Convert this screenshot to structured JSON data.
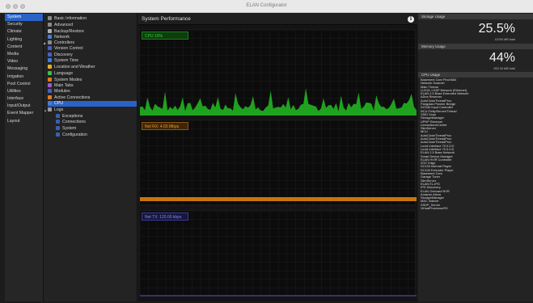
{
  "window": {
    "title": "ELAN Configurator"
  },
  "nav": {
    "items": [
      "System",
      "Security",
      "Climate",
      "Lighting",
      "Content",
      "Media",
      "Video",
      "Messaging",
      "Irrigation",
      "Pool Control",
      "Utilities",
      "Interface",
      "Input/Output",
      "Event Mapper",
      "Layout"
    ],
    "active_index": 0
  },
  "tree": {
    "items": [
      {
        "label": "Basic Information",
        "icon": "grid-icon",
        "color": "#8a8a8a",
        "indent": 0
      },
      {
        "label": "Advanced",
        "icon": "grid-icon",
        "color": "#8a8a8a",
        "indent": 0
      },
      {
        "label": "Backup/Restore",
        "icon": "backup-icon",
        "color": "#b0b0b0",
        "indent": 0
      },
      {
        "label": "Network",
        "icon": "network-icon",
        "color": "#4b7bd6",
        "indent": 0
      },
      {
        "label": "Controllers",
        "icon": "grid-icon",
        "color": "#8a8a8a",
        "indent": 0,
        "expander": "▶"
      },
      {
        "label": "Version Control",
        "icon": "circle-icon",
        "color": "#4a5fc0",
        "indent": 0
      },
      {
        "label": "Discovery",
        "icon": "circle-icon",
        "color": "#4a5fc0",
        "indent": 0
      },
      {
        "label": "System Time",
        "icon": "clock-icon",
        "color": "#3c7de0",
        "indent": 0
      },
      {
        "label": "Location and Weather",
        "icon": "weather-icon",
        "color": "#e8b020",
        "indent": 0
      },
      {
        "label": "Language",
        "icon": "globe-icon",
        "color": "#3cbf4a",
        "indent": 0
      },
      {
        "label": "System Modes",
        "icon": "modes-icon",
        "color": "#e07a20",
        "indent": 0
      },
      {
        "label": "Main Tabs",
        "icon": "tabs-icon",
        "color": "#9b59d0",
        "indent": 0
      },
      {
        "label": "Modules",
        "icon": "modules-icon",
        "color": "#4a5fc0",
        "indent": 0
      },
      {
        "label": "Active Connections",
        "icon": "connections-icon",
        "color": "#e07a20",
        "indent": 0
      },
      {
        "label": "CPU",
        "icon": "cpu-icon",
        "color": "#4b7bd6",
        "indent": 0,
        "selected": true
      },
      {
        "label": "Logs",
        "icon": "folder-icon",
        "color": "#9a9a9a",
        "indent": 0,
        "expander": "▲"
      },
      {
        "label": "Exceptions",
        "icon": "log-icon",
        "color": "#3a5fb0",
        "indent": 1
      },
      {
        "label": "Connections",
        "icon": "log-icon",
        "color": "#3a5fb0",
        "indent": 1
      },
      {
        "label": "System",
        "icon": "log-icon",
        "color": "#3a5fb0",
        "indent": 1
      },
      {
        "label": "Configuration",
        "icon": "log-icon",
        "color": "#3a5fb0",
        "indent": 1
      }
    ]
  },
  "main": {
    "title": "System Performance",
    "info_icon": "i",
    "graphs": [
      {
        "label": "CPU 10%",
        "color": "#1fa31f",
        "badge_bg": "#0e3d0e",
        "badge_border": "#1f7a1f",
        "badge_text": "#37d637",
        "value_pct": 10
      },
      {
        "label": "Net RX: 4.65 Mbps",
        "color": "#c8740c",
        "badge_bg": "#3d2606",
        "badge_border": "#8a5310",
        "badge_text": "#e89a30",
        "value_mbps": 4.65
      },
      {
        "label": "Net TX: 120.00 kbps",
        "color": "#4d4dc8",
        "badge_bg": "#161640",
        "badge_border": "#3a3a90",
        "badge_text": "#8a8ae8",
        "value_kbps": 120.0
      }
    ]
  },
  "right": {
    "storage": {
      "header": "Storage Usage",
      "value": "25.5%",
      "sub": "11003 MB total"
    },
    "memory": {
      "header": "Memory Usage",
      "value": "44%",
      "sub": "992.34 MB total"
    },
    "cpu_usage": {
      "header": "CPU Usage"
    },
    "processes": [
      "Basement Cam Pinch584",
      "Network Scanner",
      "Main Thread",
      "LUXUL LXAP Network (Ethernet)",
      "ELAN 2.5 Base Extended Network",
      "ADns Reserver",
      "AutoCloseThreadProc",
      "Pangolas Pioneer Bridge",
      "SCS40 Input Controller",
      "NCU Fixity/Server/Thread",
      "SSID Scan",
      "StorageManager",
      "UPNP Reserver",
      "LinearAlarmCenter",
      "SlimServer",
      "MCU",
      "AutoCloseThreadProc",
      "AutoCloseThreadProc",
      "AutoCloseThreadProc",
      "Lucid Interface 70.0.0.D",
      "Lucid Interface 70.0.0.D",
      "ELAN 2.5 Base Network",
      "Smart Device Manager",
      "ELAN HVIR Controller",
      "ZOC Edge",
      "SC100 Internal Player",
      "SC100 Extender Player",
      "Basement Cam",
      "Garage Tuner",
      "SlimServer",
      "ELAN EL-IPD",
      "IPD Discovery",
      "ELAN Onboard NVR",
      "Amazon Alexa",
      "StorageManager",
      "MAC Indexer",
      "SSDP_Server",
      "VirtualProcessorRX"
    ]
  }
}
